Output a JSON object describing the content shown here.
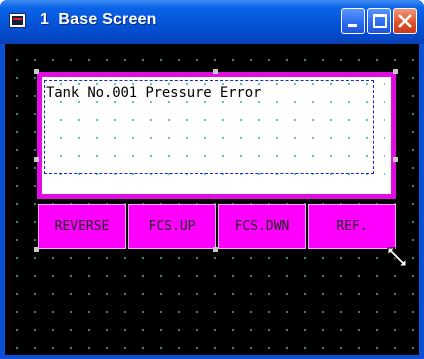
{
  "window": {
    "title": "1  Base Screen",
    "buttons": {
      "minimize": "minimize",
      "maximize": "maximize",
      "close": "close"
    }
  },
  "screen": {
    "background": "#000000",
    "alarm_panel": {
      "message": "Tank No.001 Pressure Error",
      "border_color": "#e00ee0"
    },
    "function_keys": [
      {
        "label": "REVERSE"
      },
      {
        "label": "FCS.UP"
      },
      {
        "label": "FCS.DWN"
      },
      {
        "label": "REF."
      }
    ],
    "key_color": "#ff00ff"
  },
  "icons": [
    "app-icon",
    "minimize-icon",
    "maximize-icon",
    "close-icon",
    "resize-cursor-icon"
  ]
}
